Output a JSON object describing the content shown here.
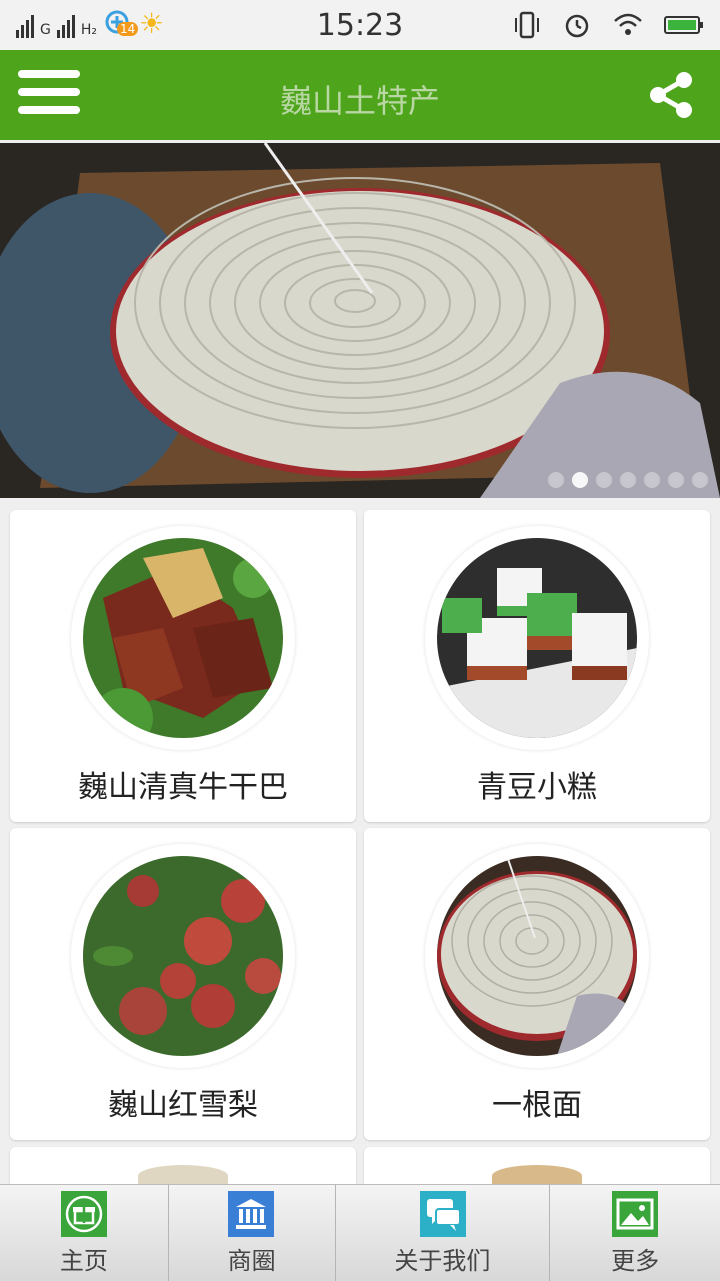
{
  "status_bar": {
    "carrier1": "G",
    "carrier2": "H₂",
    "notif_count": "14",
    "time": "15:23"
  },
  "app_bar": {
    "title": "巍山土特产",
    "menu_icon": "hamburger-menu-icon",
    "share_icon": "share-icon"
  },
  "banner": {
    "slide_count": 7,
    "active_index": 1
  },
  "products": [
    {
      "name": "巍山清真牛干巴"
    },
    {
      "name": "青豆小糕"
    },
    {
      "name": "巍山红雪梨"
    },
    {
      "name": "一根面"
    }
  ],
  "tabs": [
    {
      "label": "主页",
      "icon": "gift-icon"
    },
    {
      "label": "商圈",
      "icon": "building-icon"
    },
    {
      "label": "关于我们",
      "icon": "chat-icon"
    },
    {
      "label": "更多",
      "icon": "image-icon"
    }
  ],
  "colors": {
    "primary": "#4ea51c",
    "title_text": "#b9d7a3",
    "tab_home": "#3aa53a",
    "tab_shop": "#3a7fd6",
    "tab_about": "#2bb0c8",
    "tab_more": "#3aa53a"
  }
}
